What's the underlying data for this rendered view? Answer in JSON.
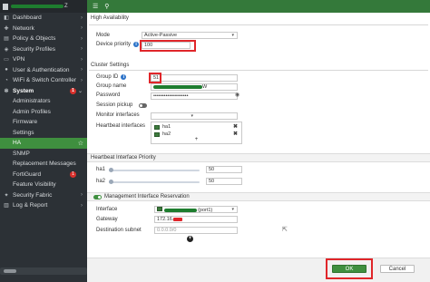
{
  "sidebar": {
    "hostname_suffix": "Z",
    "items": [
      {
        "label": "Dashboard",
        "icon": "dashboard-icon"
      },
      {
        "label": "Network",
        "icon": "network-icon"
      },
      {
        "label": "Policy & Objects",
        "icon": "policy-icon"
      },
      {
        "label": "Security Profiles",
        "icon": "shield-icon"
      },
      {
        "label": "VPN",
        "icon": "vpn-icon"
      },
      {
        "label": "User & Authentication",
        "icon": "user-icon"
      },
      {
        "label": "WiFi & Switch Controller",
        "icon": "wifi-icon"
      },
      {
        "label": "System",
        "icon": "gear-icon",
        "badge": "1"
      },
      {
        "label": "Administrators"
      },
      {
        "label": "Admin Profiles"
      },
      {
        "label": "Firmware"
      },
      {
        "label": "Settings"
      },
      {
        "label": "HA"
      },
      {
        "label": "SNMP"
      },
      {
        "label": "Replacement Messages"
      },
      {
        "label": "FortiGuard",
        "badge": "1"
      },
      {
        "label": "Feature Visibility"
      },
      {
        "label": "Security Fabric",
        "icon": "fabric-icon"
      },
      {
        "label": "Log & Report",
        "icon": "log-icon"
      }
    ]
  },
  "form": {
    "ha_section": "High Availability",
    "mode_label": "Mode",
    "mode_value": "Active-Passive",
    "priority_label": "Device priority",
    "priority_value": "100",
    "cluster_section": "Cluster Settings",
    "group_id_label": "Group ID",
    "group_id_value": "51",
    "group_name_label": "Group name",
    "group_name_suffix": "W",
    "password_label": "Password",
    "password_value": "••••••••••••••••••••",
    "session_pickup_label": "Session pickup",
    "monitor_label": "Monitor interfaces",
    "heartbeat_label": "Heartbeat interfaces",
    "heartbeat_items": [
      "ha1",
      "ha2"
    ],
    "hb_priority_section": "Heartbeat Interface Priority",
    "priority_rows": [
      {
        "name": "ha1",
        "value": "50"
      },
      {
        "name": "ha2",
        "value": "50"
      }
    ],
    "mgmt_section": "Management Interface Reservation",
    "interface_label": "Interface",
    "interface_suffix": "(port1)",
    "gateway_label": "Gateway",
    "gateway_value": "172.16.",
    "dest_label": "Destination subnet",
    "dest_placeholder": "0.0.0.0/0"
  },
  "footer": {
    "ok_label": "OK",
    "cancel_label": "Cancel"
  },
  "colors": {
    "accent": "#3f8f3f",
    "highlight": "#e0262a",
    "sidebar": "#2c3136"
  }
}
